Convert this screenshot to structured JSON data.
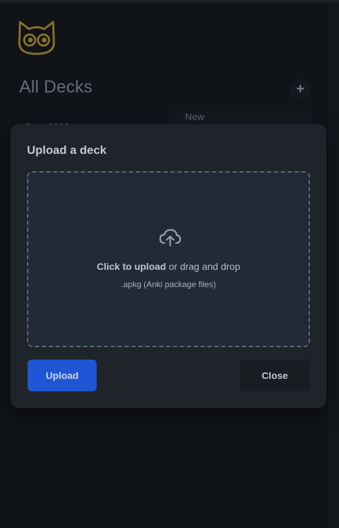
{
  "header": {
    "logo_icon": "owl-cat-logo-icon",
    "title": "All Decks",
    "add_label": "+"
  },
  "background": {
    "column_header": "New",
    "deck_name_partial": "Dem 2023"
  },
  "modal": {
    "title": "Upload a deck",
    "dropzone": {
      "icon": "cloud-upload-icon",
      "click_text": "Click to upload",
      "rest_text": " or drag and drop",
      "hint": ".apkg (Anki package files)"
    },
    "upload_label": "Upload",
    "close_label": "Close"
  },
  "colors": {
    "accent": "#2056d6",
    "logo": "#c9a63b"
  }
}
